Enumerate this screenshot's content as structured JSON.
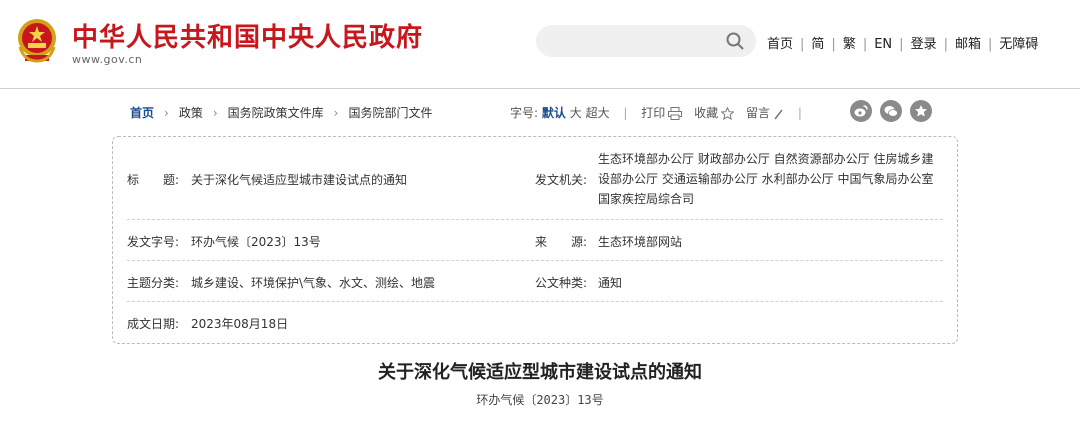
{
  "header": {
    "site_title": "中华人民共和国中央人民政府",
    "site_url": "www.gov.cn",
    "nav": [
      "首页",
      "简",
      "繁",
      "EN",
      "登录",
      "邮箱",
      "无障碍"
    ]
  },
  "breadcrumb": {
    "items": [
      "首页",
      "政策",
      "国务院政策文件库",
      "国务院部门文件"
    ]
  },
  "tools": {
    "font_label": "字号:",
    "font_default": "默认",
    "font_large": "大",
    "font_xlarge": "超大",
    "print": "打印",
    "favorite": "收藏",
    "comment": "留言"
  },
  "info": {
    "title_label": "标　　题:",
    "title_value": "关于深化气候适应型城市建设试点的通知",
    "issuer_label": "发文机关:",
    "issuer_value": "生态环境部办公厅 财政部办公厅 自然资源部办公厅 住房城乡建设部办公厅 交通运输部办公厅 水利部办公厅 中国气象局办公室 国家疾控局综合司",
    "doc_no_label": "发文字号:",
    "doc_no_value": "环办气候〔2023〕13号",
    "source_label": "来　　源:",
    "source_value": "生态环境部网站",
    "topic_label": "主题分类:",
    "topic_value": "城乡建设、环境保护\\气象、水文、测绘、地震",
    "type_label": "公文种类:",
    "type_value": "通知",
    "date_label": "成文日期:",
    "date_value": "2023年08月18日"
  },
  "article": {
    "title": "关于深化气候适应型城市建设试点的通知",
    "doc_no": "环办气候〔2023〕13号"
  },
  "colors": {
    "brand_red": "#c8161d",
    "link_blue": "#1a4d8f"
  }
}
